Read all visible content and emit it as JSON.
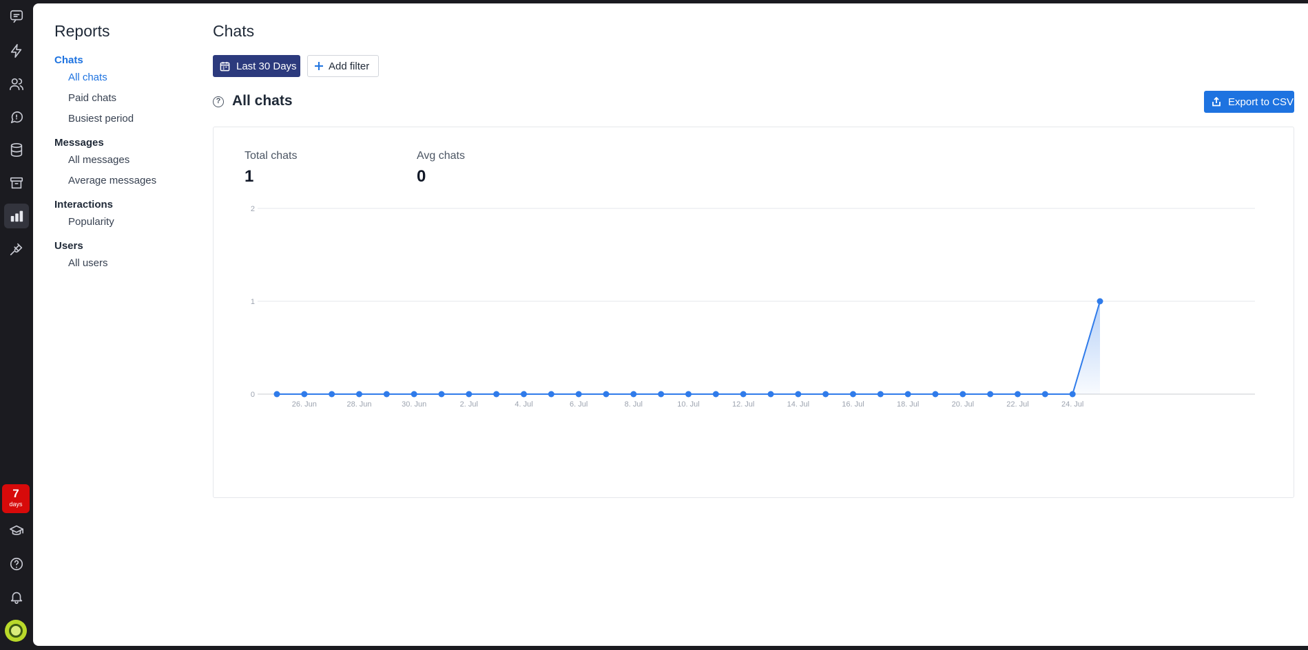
{
  "rail": {
    "trial_days": "7",
    "trial_unit": "days"
  },
  "reports_nav": {
    "title": "Reports",
    "sections": [
      {
        "label": "Chats",
        "items": [
          "All chats",
          "Paid chats",
          "Busiest period"
        ]
      },
      {
        "label": "Messages",
        "items": [
          "All messages",
          "Average messages"
        ]
      },
      {
        "label": "Interactions",
        "items": [
          "Popularity"
        ]
      },
      {
        "label": "Users",
        "items": [
          "All users"
        ]
      }
    ],
    "active_item": "All chats"
  },
  "content": {
    "title": "Chats",
    "date_button": "Last 30 Days",
    "filter_button": "Add filter",
    "section_title": "All chats",
    "help_glyph": "?",
    "export_button": "Export to CSV",
    "stats": [
      {
        "label": "Total chats",
        "value": "1"
      },
      {
        "label": "Avg chats",
        "value": "0"
      }
    ]
  },
  "colors": {
    "accent": "#1e73e0",
    "date_button": "#2c3a7d",
    "rail": "#1b1b20",
    "trial_badge": "#d70a0a"
  },
  "chart_data": {
    "type": "area",
    "title": "",
    "xlabel": "",
    "ylabel": "",
    "ylim": [
      0,
      2
    ],
    "y_ticks": [
      "0",
      "1",
      "2"
    ],
    "grid": true,
    "x": [
      "25. Jun",
      "26. Jun",
      "27. Jun",
      "28. Jun",
      "29. Jun",
      "30. Jun",
      "1. Jul",
      "2. Jul",
      "3. Jul",
      "4. Jul",
      "5. Jul",
      "6. Jul",
      "7. Jul",
      "8. Jul",
      "9. Jul",
      "10. Jul",
      "11. Jul",
      "12. Jul",
      "13. Jul",
      "14. Jul",
      "15. Jul",
      "16. Jul",
      "17. Jul",
      "18. Jul",
      "19. Jul",
      "20. Jul",
      "21. Jul",
      "22. Jul",
      "23. Jul",
      "24. Jul",
      "25. Jul"
    ],
    "x_tick_labels": [
      "26. Jun",
      "28. Jun",
      "30. Jun",
      "2. Jul",
      "4. Jul",
      "6. Jul",
      "8. Jul",
      "10. Jul",
      "12. Jul",
      "14. Jul",
      "16. Jul",
      "18. Jul",
      "20. Jul",
      "22. Jul",
      "24. Jul"
    ],
    "series": [
      {
        "values": [
          0,
          0,
          0,
          0,
          0,
          0,
          0,
          0,
          0,
          0,
          0,
          0,
          0,
          0,
          0,
          0,
          0,
          0,
          0,
          0,
          0,
          0,
          0,
          0,
          0,
          0,
          0,
          0,
          0,
          0,
          1
        ],
        "color": "#2f7bea"
      }
    ]
  }
}
